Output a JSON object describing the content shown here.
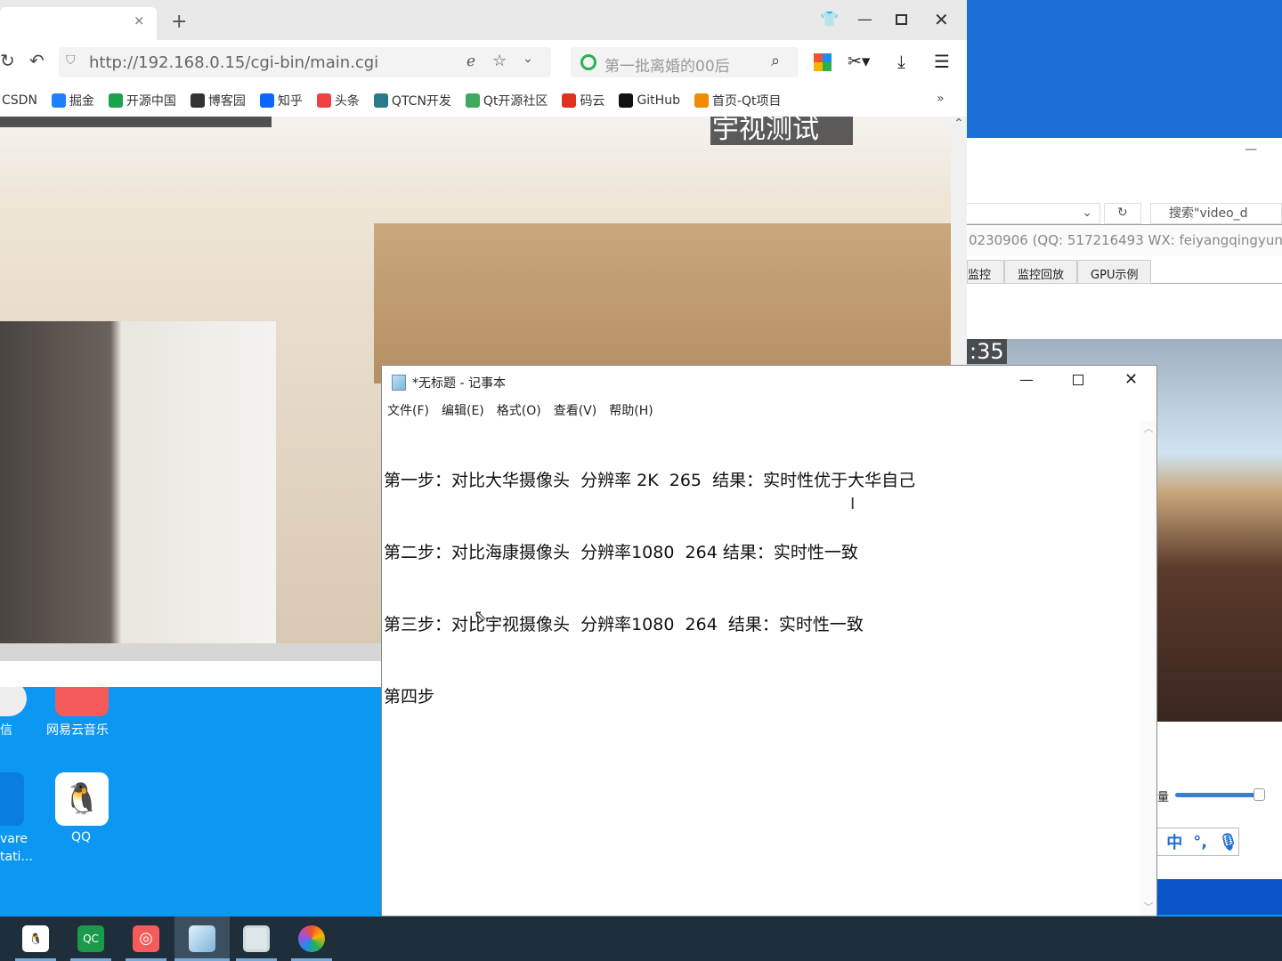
{
  "browser": {
    "tab_close": "×",
    "new_tab": "+",
    "url": "http://192.168.0.15/cgi-bin/main.cgi",
    "search_hint": "第一批离婚的00后",
    "bookmarks": [
      {
        "label": "CSDN",
        "color": ""
      },
      {
        "label": "掘金",
        "color": "#1e80ff"
      },
      {
        "label": "开源中国",
        "color": "#1aa34a"
      },
      {
        "label": "博客园",
        "color": "#333333"
      },
      {
        "label": "知乎",
        "color": "#0a66ff"
      },
      {
        "label": "头条",
        "color": "#f04142"
      },
      {
        "label": "QTCN开发",
        "color": "#2a7a8a"
      },
      {
        "label": "Qt开源社区",
        "color": "#41a85f"
      },
      {
        "label": "码云",
        "color": "#e0301e"
      },
      {
        "label": "GitHub",
        "color": "#111111"
      },
      {
        "label": "首页-Qt项目",
        "color": "#f08a00"
      }
    ],
    "more": "»",
    "video_overlay": "宇视测试"
  },
  "right_window": {
    "search": "搜索\"video_d",
    "title": "0230906 (QQ: 517216493 WX: feiyangqingyun)",
    "tabs": [
      "监控",
      "监控回放",
      "GPU示例"
    ],
    "time": ":35",
    "volume_label": "量",
    "volume": 0.95
  },
  "ime": {
    "mode": "中",
    "punct": "°,"
  },
  "notepad": {
    "title": "*无标题 - 记事本",
    "menu": [
      "文件(F)",
      "编辑(E)",
      "格式(O)",
      "查看(V)",
      "帮助(H)"
    ],
    "lines": [
      "第一步：对比大华摄像头  分辨率 2K  265  结果：实时性优于大华自己",
      "第二步：对比海康摄像头  分辨率1080  264 结果：实时性一致",
      "第三步：对比宇视摄像头  分辨率1080  264  结果：实时性一致",
      "第四步"
    ]
  },
  "desktop": {
    "icons": [
      {
        "label": "信"
      },
      {
        "label": "网易云音乐"
      },
      {
        "label": "vare\ntati..."
      },
      {
        "label": "QQ"
      }
    ]
  },
  "taskbar": {
    "apps": [
      "QQ",
      "QC",
      "网易云音乐",
      "记事本",
      "窗口",
      "浏览器"
    ],
    "qc_label": "QC"
  }
}
